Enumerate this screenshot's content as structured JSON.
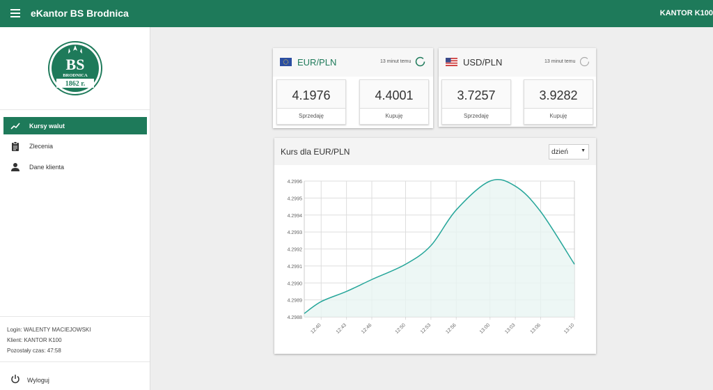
{
  "header": {
    "app_title": "eKantor BS Brodnica",
    "account": "KANTOR K100"
  },
  "logo": {
    "letters": "BS",
    "name": "BRODNICA",
    "year": "1862 r."
  },
  "sidebar": {
    "items": [
      {
        "label": "Kursy walut",
        "icon": "trending-up-icon",
        "active": true
      },
      {
        "label": "Zlecenia",
        "icon": "clipboard-icon",
        "active": false
      },
      {
        "label": "Dane klienta",
        "icon": "person-icon",
        "active": false
      }
    ],
    "info": {
      "login": "Login: WALENTY MACIEJOWSKI",
      "client": "Klient: KANTOR K100",
      "remaining": "Pozostały czas: 47:58"
    },
    "logout_label": "Wyloguj",
    "logout_icon": "power-icon"
  },
  "rates": [
    {
      "pair": "EUR/PLN",
      "flag": "eu-flag-icon",
      "updated": "13 minut temu",
      "sell_value": "4.1976",
      "sell_label": "Sprzedaję",
      "buy_value": "4.4001",
      "buy_label": "Kupuję"
    },
    {
      "pair": "USD/PLN",
      "flag": "us-flag-icon",
      "updated": "13 minut temu",
      "sell_value": "3.7257",
      "sell_label": "Sprzedaję",
      "buy_value": "3.9282",
      "buy_label": "Kupuję"
    }
  ],
  "chart_panel": {
    "title": "Kurs dla EUR/PLN",
    "period_selected": "dzień"
  },
  "colors": {
    "brand": "#1e7a5a",
    "line": "#26a69a",
    "fill": "#e8f5f3"
  },
  "chart_data": {
    "type": "area",
    "x": [
      "12:38",
      "12:40",
      "12:43",
      "12:46",
      "12:50",
      "12:53",
      "12:56",
      "13:00",
      "13:03",
      "13:06",
      "13:10"
    ],
    "xticks": [
      "12:40",
      "12:43",
      "12:46",
      "12:50",
      "12:53",
      "12:56",
      "13:00",
      "13:03",
      "13:06",
      "13:10"
    ],
    "values": [
      4.29882,
      4.29889,
      4.29895,
      4.29902,
      4.29911,
      4.29922,
      4.29943,
      4.2996,
      4.29957,
      4.29942,
      4.29911
    ],
    "yticks": [
      "4.2988",
      "4.2989",
      "4.2990",
      "4.2991",
      "4.2992",
      "4.2993",
      "4.2994",
      "4.2995",
      "4.2996"
    ],
    "ylim": [
      4.2988,
      4.2996
    ],
    "title": "",
    "xlabel": "",
    "ylabel": "",
    "grid": true,
    "legend": false
  }
}
